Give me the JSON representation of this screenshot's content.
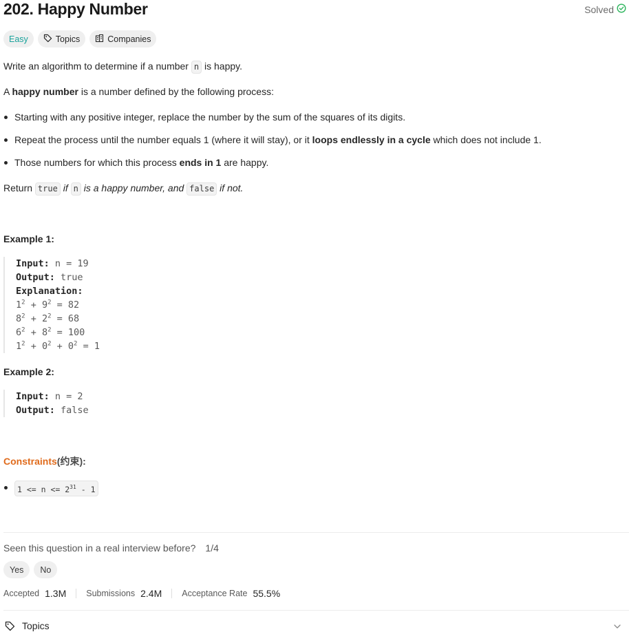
{
  "header": {
    "title": "202. Happy Number",
    "status": "Solved",
    "status_color": "#2db55d"
  },
  "tags": {
    "difficulty": "Easy",
    "topics": "Topics",
    "companies": "Companies"
  },
  "description": {
    "line1_pre": "Write an algorithm to determine if a number ",
    "line1_code": "n",
    "line1_post": " is happy.",
    "line2_pre": "A ",
    "line2_bold": "happy number",
    "line2_post": " is a number defined by the following process:",
    "bullets": [
      {
        "pre": "Starting with any positive integer, replace the number by the sum of the squares of its digits.",
        "bold": "",
        "post": ""
      },
      {
        "pre": "Repeat the process until the number equals 1 (where it will stay), or it ",
        "bold": "loops endlessly in a cycle",
        "post": " which does not include 1."
      },
      {
        "pre": "Those numbers for which this process ",
        "bold": "ends in 1",
        "post": " are happy."
      }
    ],
    "return_pre": "Return ",
    "return_code1": "true",
    "return_mid1": " if ",
    "return_code2": "n",
    "return_mid2": " is a happy number, and ",
    "return_code3": "false",
    "return_post": " if not."
  },
  "example1": {
    "heading": "Example 1:",
    "input_label": "Input:",
    "input_value": " n = 19",
    "output_label": "Output:",
    "output_value": " true",
    "explanation_label": "Explanation:",
    "lines": [
      [
        "1",
        "2",
        " + 9",
        "2",
        " = 82",
        "",
        ""
      ],
      [
        "8",
        "2",
        " + 2",
        "2",
        " = 68",
        "",
        ""
      ],
      [
        "6",
        "2",
        " + 8",
        "2",
        " = 100",
        "",
        ""
      ],
      [
        "1",
        "2",
        " + 0",
        "2",
        " + 0",
        "2",
        " = 1"
      ]
    ]
  },
  "example2": {
    "heading": "Example 2:",
    "input_label": "Input:",
    "input_value": " n = 2",
    "output_label": "Output:",
    "output_value": " false"
  },
  "constraints": {
    "title": "Constraints",
    "title_cn": "(约束):",
    "item_pre": "1 <= n <= 2",
    "item_sup": "31",
    "item_post": " - 1"
  },
  "feedback": {
    "question": "Seen this question in a real interview before?",
    "count": "1/4",
    "yes": "Yes",
    "no": "No"
  },
  "stats": {
    "accepted_label": "Accepted",
    "accepted_value": "1.3M",
    "submissions_label": "Submissions",
    "submissions_value": "2.4M",
    "rate_label": "Acceptance Rate",
    "rate_value": "55.5%"
  },
  "footer": {
    "topics": "Topics"
  },
  "colors": {
    "easy": "#1ba39c",
    "constraints": "#e06b1c"
  }
}
